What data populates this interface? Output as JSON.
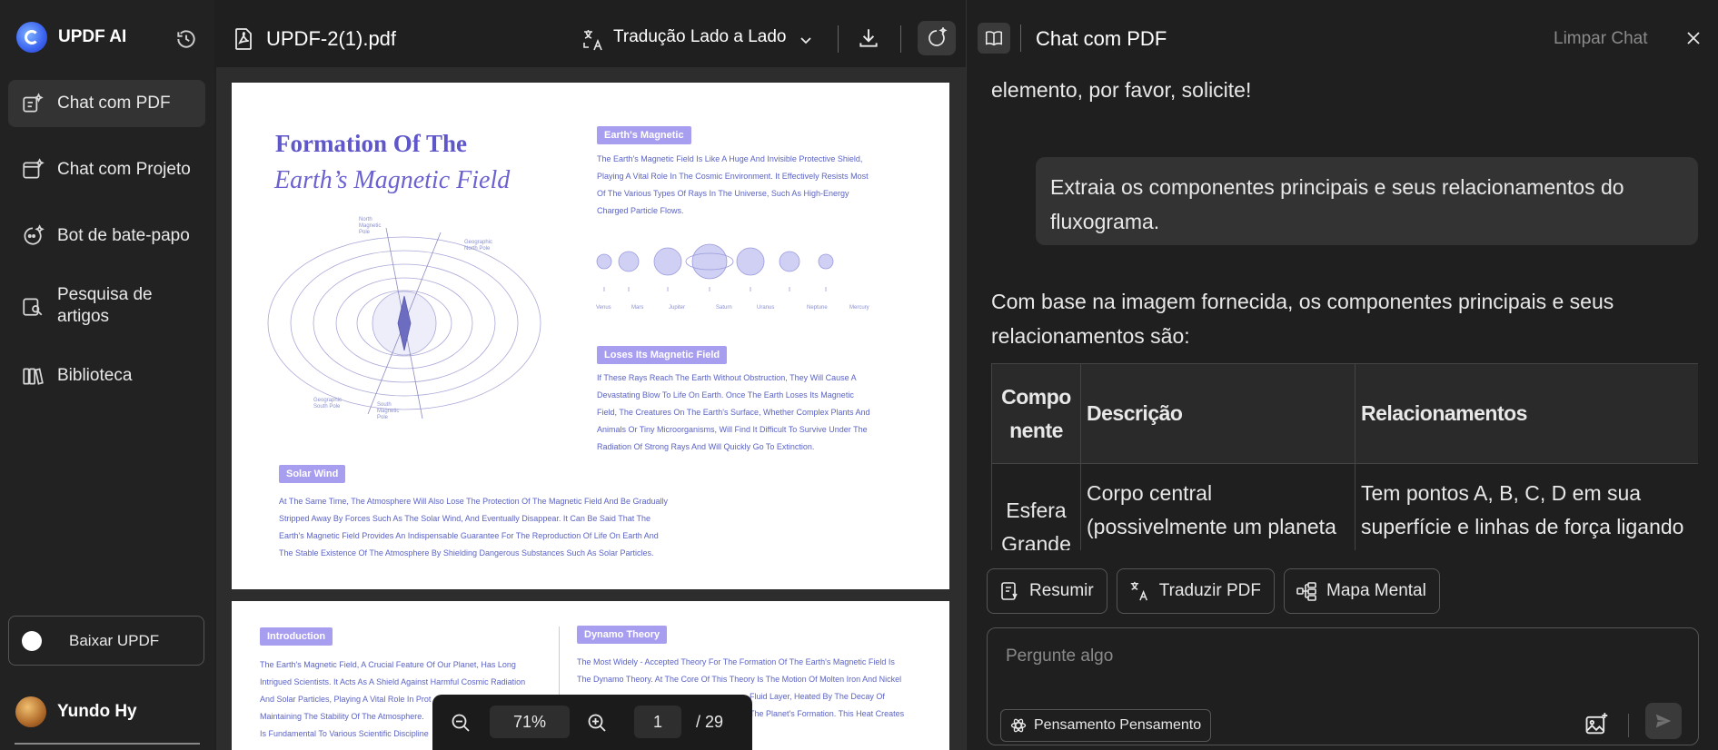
{
  "sidebar": {
    "brand": "UPDF AI",
    "items": [
      {
        "label": "Chat com PDF"
      },
      {
        "label": "Chat com Projeto"
      },
      {
        "label": "Bot de bate-papo"
      },
      {
        "label": "Pesquisa de artigos"
      },
      {
        "label": "Biblioteca"
      }
    ],
    "download_label": "Baixar UPDF",
    "user_name": "Yundo Hy"
  },
  "pdf": {
    "file_name": "UPDF-2(1).pdf",
    "translate_mode": "Tradução Lado a Lado",
    "zoom": "71%",
    "current_page": "1",
    "total_pages": "/ 29",
    "page1": {
      "title_line1": "Formation Of The",
      "title_line2": "Earth’s Magnetic Field",
      "section1_tag": "Earth's Magnetic",
      "section1_lines": [
        "The Earth's Magnetic Field Is Like A Huge And Invisible Protective Shield,",
        "Playing A Vital Role In The Cosmic Environment. It Effectively Resists Most",
        "Of The Various Types Of Rays In The Universe, Such As High-Energy",
        "Charged Particle Flows."
      ],
      "planets": [
        "Venus",
        "Mars",
        "Jupiter",
        "Saturn",
        "Uranus",
        "Neptune",
        "Mercury"
      ],
      "diagram_labels": {
        "north": "North Magnetic Pole",
        "geo_north": "Geographic North Pole",
        "geo_south": "Geographic South Pole",
        "south": "South Magnetic Pole"
      },
      "section2_tag": "Loses Its Magnetic Field",
      "section2_lines": [
        "If These Rays Reach The Earth Without Obstruction, They Will Cause A",
        "Devastating Blow To Life On Earth. Once The Earth Loses Its Magnetic",
        "Field, The Creatures On The Earth's Surface, Whether Complex Plants And",
        "Animals Or Tiny Microorganisms, Will Find It Difficult To Survive Under The",
        "Radiation Of Strong Rays And Will Quickly Go To Extinction."
      ],
      "section3_tag": "Solar Wind",
      "section3_lines": [
        "At The Same Time, The Atmosphere Will Also Lose The Protection Of The Magnetic Field And Be Gradually",
        "Stripped Away By Forces Such As The Solar Wind, And Eventually Disappear. It Can Be Said That The",
        "Earth's Magnetic Field Provides An Indispensable Guarantee For The Reproduction Of Life On Earth And",
        "The Stable Existence Of The Atmosphere By Shielding Dangerous Substances Such As Solar Particles."
      ]
    },
    "page2": {
      "intro_tag": "Introduction",
      "intro_lines": [
        "The Earth's Magnetic Field, A Crucial Feature Of Our Planet, Has Long",
        "Intrigued Scientists. It Acts As A Shield Against Harmful Cosmic Radiation",
        "And Solar Particles, Playing A Vital Role In Prot",
        "Maintaining The Stability Of The Atmosphere.",
        "Is Fundamental To Various Scientific Discipline"
      ],
      "dynamo_tag": "Dynamo Theory",
      "dynamo_lines": [
        "The Most Widely - Accepted Theory For The Formation Of The Earth's Magnetic Field Is",
        "The Dynamo Theory. At The Core Of This Theory Is The Motion Of Molten Iron And Nickel",
        "Fluid Layer, Heated By The Decay Of",
        "The Planet's Formation. This Heat Creates"
      ]
    }
  },
  "chat": {
    "title": "Chat com PDF",
    "clear_label": "Limpar Chat",
    "partial_message": "elemento, por favor, solicite!",
    "user_message": "Extraia os componentes principais e seus relacionamentos do fluxograma.",
    "ai_intro": "Com base na imagem fornecida, os componentes principais e seus relacionamentos são:",
    "table": {
      "headers": [
        "Compo nente",
        "Descrição",
        "Relacionamentos"
      ],
      "rows": [
        [
          "Esfera Grande",
          "Corpo central (possivelmente um planeta ou objeto O)",
          "Tem pontos A, B, C, D em sua superfície e linhas de força ligando a"
        ]
      ]
    },
    "actions": [
      "Resumir",
      "Traduzir PDF",
      "Mapa Mental"
    ],
    "input_placeholder": "Pergunte algo",
    "thinking_label": "Pensamento Pensamento"
  }
}
